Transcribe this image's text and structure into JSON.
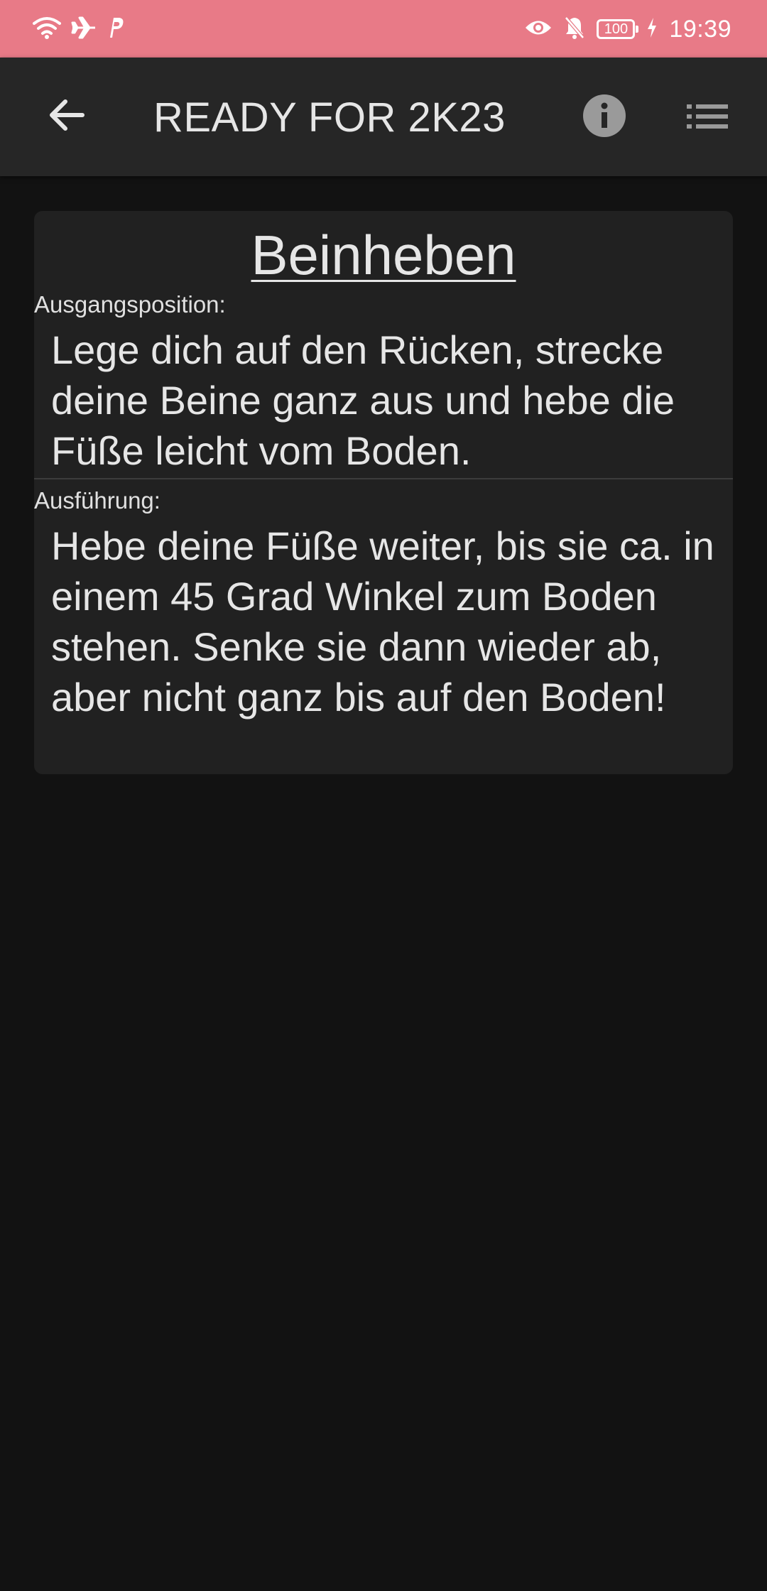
{
  "status_bar": {
    "time": "19:39",
    "battery": "100",
    "icons": [
      "wifi-icon",
      "airplane-icon",
      "paypal-icon",
      "eye-icon",
      "bell-off-icon",
      "battery-icon",
      "charging-icon"
    ]
  },
  "app_bar": {
    "title": "READY FOR 2K23",
    "icons": [
      "arrow-back-icon",
      "info-icon",
      "list-icon"
    ]
  },
  "exercise": {
    "title": "Beinheben",
    "start_label": "Ausgangsposition:",
    "start_text": "Lege dich auf den Rücken, strecke deine Beine ganz aus und hebe die Füße leicht vom Boden.",
    "execution_label": "Ausführung:",
    "execution_text": "Hebe deine Füße weiter, bis sie ca. in einem 45 Grad Winkel zum Boden stehen. Senke sie dann wieder ab, aber nicht ganz bis auf den Boden!"
  },
  "colors": {
    "status_bar": "#e87a87",
    "app_bar": "#262626",
    "background": "#121212",
    "card": "#212121",
    "text": "#e6e6e6"
  }
}
